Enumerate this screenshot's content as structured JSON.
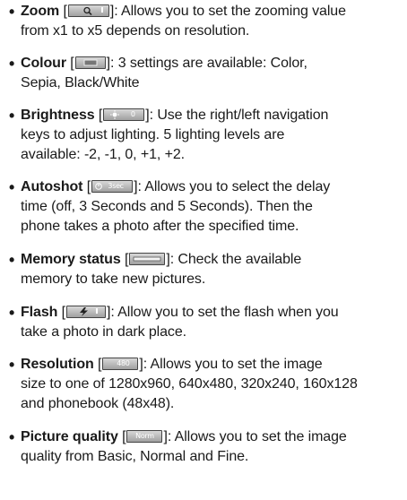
{
  "items": [
    {
      "term": "Zoom",
      "icon": "zoom-icon",
      "lines": [
        ": Allows you to set the zooming value",
        "from x1 to x5 depends on resolution."
      ]
    },
    {
      "term": "Colour",
      "icon": "colour-icon",
      "lines": [
        ": 3 settings are available: Color,",
        "Sepia, Black/White"
      ]
    },
    {
      "term": "Brightness",
      "icon": "brightness-icon",
      "icon_text": "0",
      "lines": [
        ": Use the right/left navigation",
        "keys to adjust lighting. 5 lighting levels are",
        "available: -2, -1, 0, +1, +2."
      ]
    },
    {
      "term": "Autoshot",
      "icon": "autoshot-icon",
      "icon_text": "3sec",
      "lines": [
        ": Allows you to select the delay",
        "time (off, 3 Seconds and 5 Seconds). Then the",
        "phone takes a photo after the specified time."
      ]
    },
    {
      "term": "Memory status",
      "icon": "memory-status-icon",
      "lines": [
        ": Check the available",
        "memory to take new pictures."
      ]
    },
    {
      "term": "Flash",
      "icon": "flash-icon",
      "lines": [
        ": Allow you to set the flash when you",
        "take a photo in dark place."
      ]
    },
    {
      "term": "Resolution",
      "icon": "resolution-icon",
      "icon_text": "480",
      "lines": [
        ": Allows you to set the image",
        "size to one of 1280x960, 640x480, 320x240, 160x128",
        "and phonebook (48x48)."
      ]
    },
    {
      "term": "Picture quality",
      "icon": "picture-quality-icon",
      "icon_text": "Norm",
      "lines": [
        ": Allows you to set the image",
        "quality from Basic, Normal and Fine."
      ]
    }
  ]
}
